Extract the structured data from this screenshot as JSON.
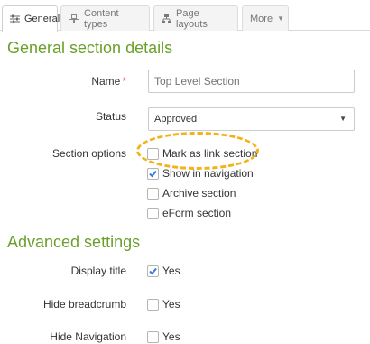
{
  "tabs": [
    {
      "label": "General",
      "icon": "sliders-icon",
      "active": true
    },
    {
      "label": "Content types",
      "icon": "cubes-icon",
      "active": false
    },
    {
      "label": "Page layouts",
      "icon": "sitemap-icon",
      "active": false
    },
    {
      "label": "More",
      "icon": "caret-down-icon",
      "active": false
    }
  ],
  "general": {
    "title": "General section details",
    "name_label": "Name",
    "name_required": "*",
    "name_placeholder": "Top Level Section",
    "status_label": "Status",
    "status_value": "Approved",
    "options_label": "Section options",
    "options": [
      {
        "label": "Mark as link section",
        "checked": false
      },
      {
        "label": "Show in navigation",
        "checked": true
      },
      {
        "label": "Archive section",
        "checked": false
      },
      {
        "label": "eForm section",
        "checked": false
      }
    ]
  },
  "advanced": {
    "title": "Advanced settings",
    "rows": [
      {
        "label": "Display title",
        "option": "Yes",
        "checked": true
      },
      {
        "label": "Hide breadcrumb",
        "option": "Yes",
        "checked": false
      },
      {
        "label": "Hide Navigation",
        "option": "Yes",
        "checked": false
      }
    ]
  },
  "colors": {
    "heading": "#6aa02a",
    "checkmark": "#3a7bd5",
    "highlight": "#f2b318",
    "required": "#d9534f"
  }
}
